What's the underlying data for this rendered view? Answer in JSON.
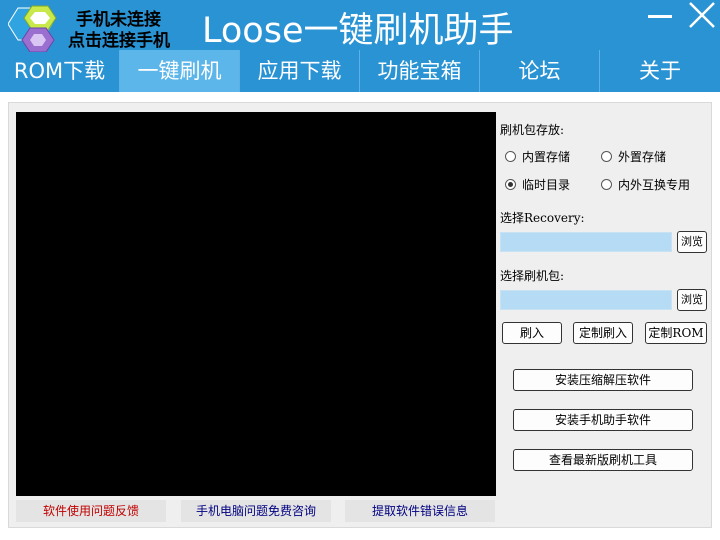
{
  "header": {
    "status_line1": "手机未连接",
    "status_line2": "点击连接手机",
    "title": "Loose一键刷机助手",
    "logo_icon": "flash-tool-logo-icon",
    "minimize_icon": "minimize-icon",
    "close_icon": "close-icon",
    "accent_color": "#2a93d4"
  },
  "tabs": [
    {
      "label": "ROM下载"
    },
    {
      "label": "一键刷机",
      "active": true
    },
    {
      "label": "应用下载"
    },
    {
      "label": "功能宝箱"
    },
    {
      "label": "论坛"
    },
    {
      "label": "关于"
    }
  ],
  "panel": {
    "package_location_label": "刷机包存放:",
    "radios": [
      {
        "label": "内置存储",
        "checked": false
      },
      {
        "label": "外置存储",
        "checked": false
      },
      {
        "label": "临时目录",
        "checked": true
      },
      {
        "label": "内外互换专用",
        "checked": false
      }
    ],
    "recovery_label": "选择Recovery:",
    "recovery_value": "",
    "browse_label": "浏览",
    "package_label": "选择刷机包:",
    "package_value": "",
    "flash_button": "刷入",
    "custom_flash_button": "定制刷入",
    "custom_rom_button": "定制ROM",
    "install_unzip_button": "安装压缩解压软件",
    "install_assistant_button": "安装手机助手软件",
    "latest_tools_button": "查看最新版刷机工具"
  },
  "footer": {
    "feedback_link": "软件使用问题反馈",
    "consult_link": "手机电脑问题免费咨询",
    "error_info_link": "提取软件错误信息",
    "feedback_color": "#c00000",
    "link_color": "#000080"
  }
}
